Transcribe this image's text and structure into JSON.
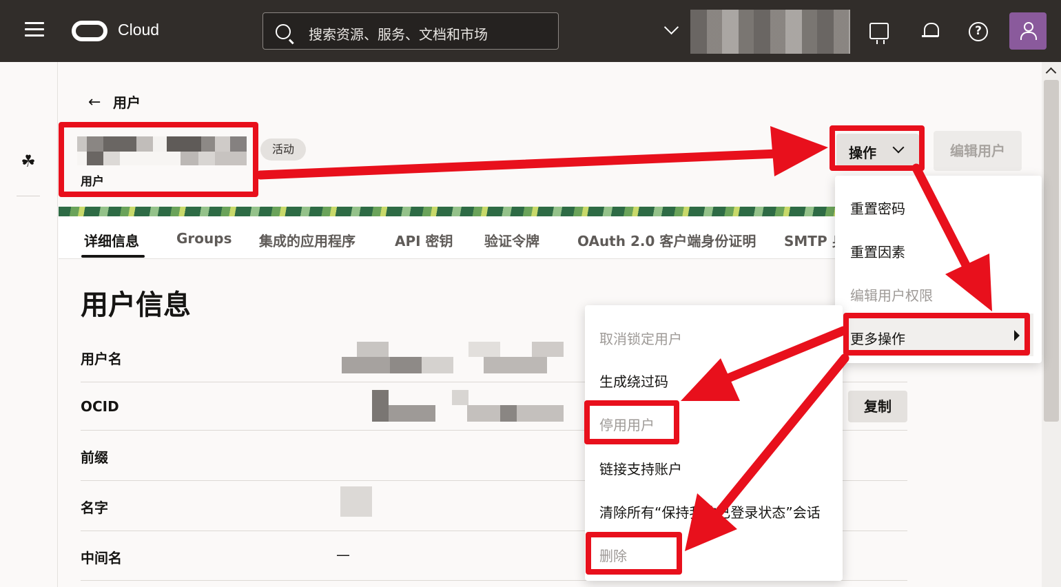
{
  "header": {
    "brand": "Cloud",
    "search_placeholder": "搜索资源、服务、文档和市场",
    "icons": [
      "menu-icon",
      "oracle-logo",
      "search-icon",
      "chevron-down-icon",
      "cloud-shell-icon",
      "bell-icon",
      "help-icon",
      "user-avatar-icon"
    ]
  },
  "breadcrumb": {
    "back_label": "用户"
  },
  "user": {
    "subtitle": "用户",
    "status": "活动"
  },
  "toolbar": {
    "actions_label": "操作",
    "edit_label": "编辑用户"
  },
  "tabs": [
    "详细信息",
    "Groups",
    "集成的应用程序",
    "API 密钥",
    "验证令牌",
    "OAuth 2.0 客户端身份证明",
    "SMTP 身"
  ],
  "section": {
    "title": "用户信息",
    "rows": [
      {
        "label": "用户名",
        "value": ""
      },
      {
        "label": "OCID",
        "value": ""
      },
      {
        "label": "前缀",
        "value": ""
      },
      {
        "label": "名字",
        "value": ""
      },
      {
        "label": "中间名",
        "value": "—"
      }
    ],
    "copy_label": "复制"
  },
  "actions_menu": {
    "items": [
      {
        "label": "重置密码",
        "disabled": false
      },
      {
        "label": "重置因素",
        "disabled": false
      },
      {
        "label": "编辑用户权限",
        "disabled": true
      },
      {
        "label": "更多操作",
        "disabled": false,
        "submenu": true
      }
    ]
  },
  "more_actions_menu": {
    "items": [
      {
        "label": "取消锁定用户",
        "disabled": true
      },
      {
        "label": "生成绕过码",
        "disabled": false
      },
      {
        "label": "停用用户",
        "disabled": true
      },
      {
        "label": "链接支持账户",
        "disabled": false
      },
      {
        "label": "清除所有“保持我的已登录状态”会话",
        "disabled": false
      },
      {
        "label": "删除",
        "disabled": true
      }
    ]
  },
  "annotation_color": "#e8101c"
}
